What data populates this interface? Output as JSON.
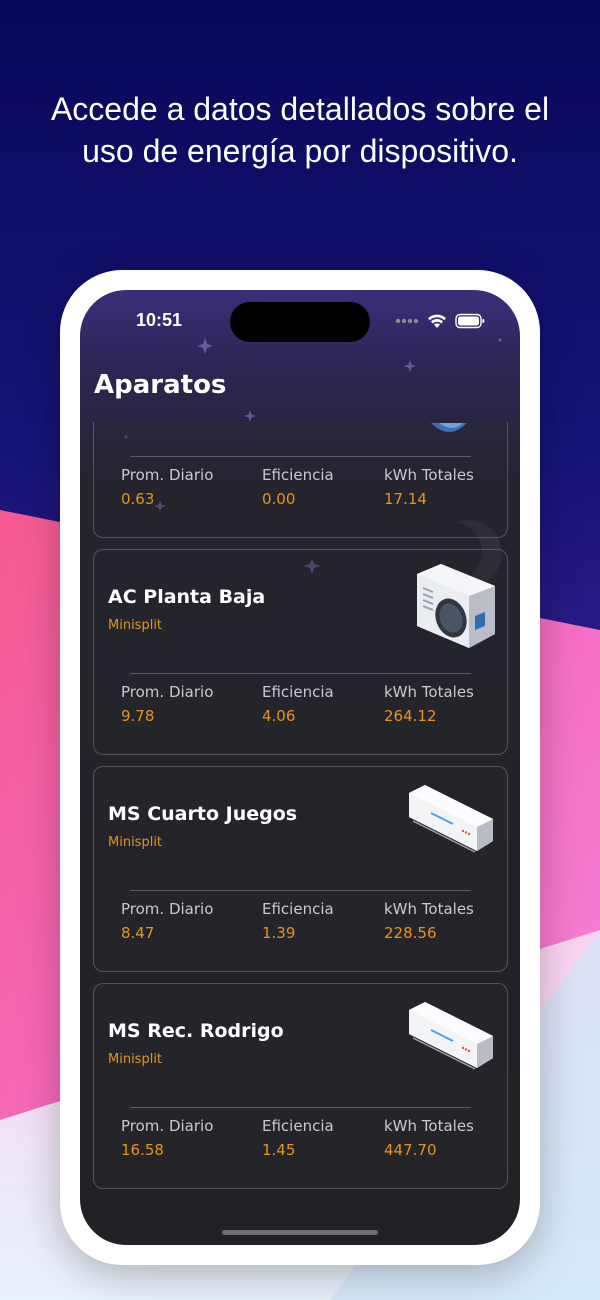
{
  "headline": "Accede a datos detallados sobre el uso de energía por dispositivo.",
  "status_bar": {
    "time": "10:51"
  },
  "screen_title": "Aparatos",
  "stat_labels": {
    "daily": "Prom. Diario",
    "efficiency": "Eficiencia",
    "total": "kWh Totales"
  },
  "devices": [
    {
      "name": "",
      "type": "",
      "daily": "0.63",
      "efficiency": "0.00",
      "total": "17.14",
      "image": "partial-device"
    },
    {
      "name": "AC Planta Baja",
      "type": "Minisplit",
      "daily": "9.78",
      "efficiency": "4.06",
      "total": "264.12",
      "image": "ac-outdoor-unit-icon"
    },
    {
      "name": "MS Cuarto Juegos",
      "type": "Minisplit",
      "daily": "8.47",
      "efficiency": "1.39",
      "total": "228.56",
      "image": "minisplit-indoor-unit-icon"
    },
    {
      "name": "MS Rec. Rodrigo",
      "type": "Minisplit",
      "daily": "16.58",
      "efficiency": "1.45",
      "total": "447.70",
      "image": "minisplit-indoor-unit-icon"
    }
  ],
  "colors": {
    "accent": "#e8941c",
    "background_top": "#0a0859",
    "pink_band": "#f564a8",
    "screen_bg": "#222226"
  }
}
